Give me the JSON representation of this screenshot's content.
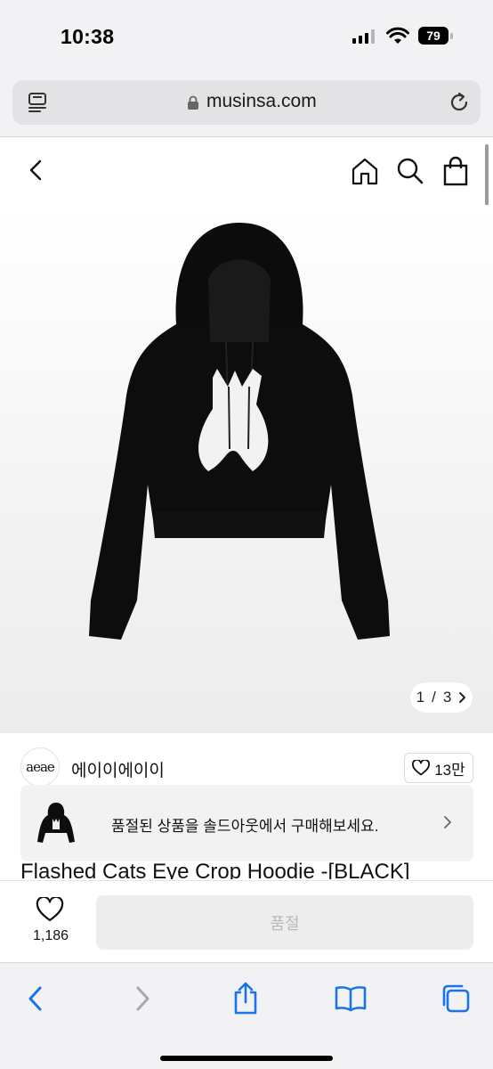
{
  "status_bar": {
    "time": "10:38",
    "battery": "79"
  },
  "browser": {
    "domain": "musinsa.com"
  },
  "gallery": {
    "current": "1",
    "separator": "/",
    "total": "3"
  },
  "brand": {
    "logo_text": "aeae",
    "name": "에이이에이이",
    "likes": "13만"
  },
  "soldout_banner": {
    "message": "품절된 상품을 솔드아웃에서 구매해보세요."
  },
  "product": {
    "title": "Flashed Cats Eye Crop Hoodie -[BLACK]"
  },
  "purchase_bar": {
    "like_count": "1,186",
    "button_label": "품절"
  }
}
